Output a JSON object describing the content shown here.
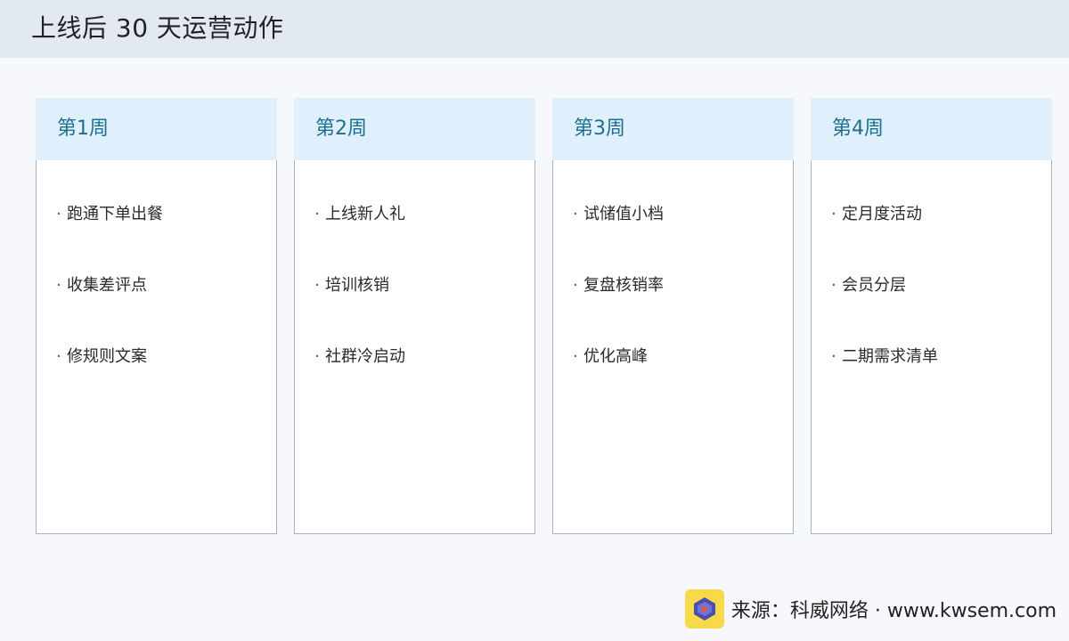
{
  "page": {
    "title": "上线后 30 天运营动作"
  },
  "weeks": [
    {
      "label": "第1周",
      "tasks": [
        "跑通下单出餐",
        "收集差评点",
        "修规则文案"
      ]
    },
    {
      "label": "第2周",
      "tasks": [
        "上线新人礼",
        "培训核销",
        "社群冷启动"
      ]
    },
    {
      "label": "第3周",
      "tasks": [
        "试储值小档",
        "复盘核销率",
        "优化高峰"
      ]
    },
    {
      "label": "第4周",
      "tasks": [
        "定月度活动",
        "会员分层",
        "二期需求清单"
      ]
    }
  ],
  "bullet": "·",
  "footer": {
    "source": "来源：科威网络 · www.kwsem.com",
    "logo_icon": "kwsem-logo-icon"
  },
  "colors": {
    "header_bg": "#e3e9f0",
    "card_head_bg": "#dff0fc",
    "card_head_text": "#1c6f8e",
    "card_border": "#a9b2bd",
    "logo_bg": "#f7d94a"
  }
}
